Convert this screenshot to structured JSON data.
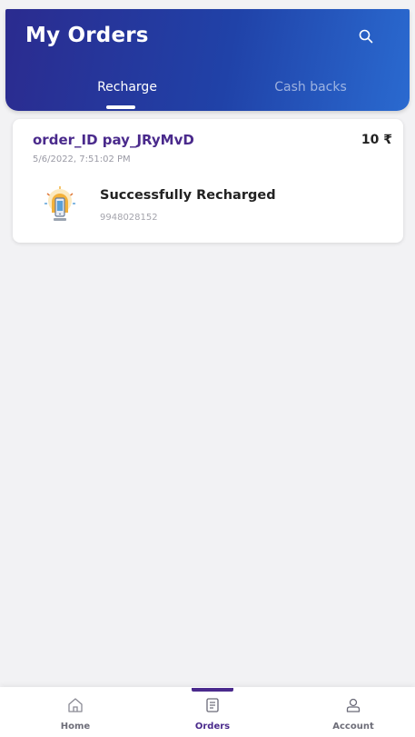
{
  "header": {
    "title": "My Orders",
    "search_icon": "search-icon",
    "tabs": [
      {
        "label": "Recharge",
        "active": true
      },
      {
        "label": "Cash backs",
        "active": false
      }
    ]
  },
  "orders": [
    {
      "order_id": "order_ID pay_JRyMvD",
      "amount": "10 ₹",
      "datetime": "5/6/2022, 7:51:02 PM",
      "icon": "recharge-icon",
      "status": "Successfully Recharged",
      "phone": "9948028152"
    }
  ],
  "bottom_nav": {
    "active": "Orders",
    "items": [
      {
        "label": "Home",
        "icon": "home-icon"
      },
      {
        "label": "Orders",
        "icon": "orders-icon"
      },
      {
        "label": "Account",
        "icon": "account-icon"
      }
    ]
  },
  "colors": {
    "header_gradient_start": "#2b2b8f",
    "header_gradient_end": "#2a6ad0",
    "accent_purple": "#4a2a8c",
    "background": "#f2f2f4"
  }
}
